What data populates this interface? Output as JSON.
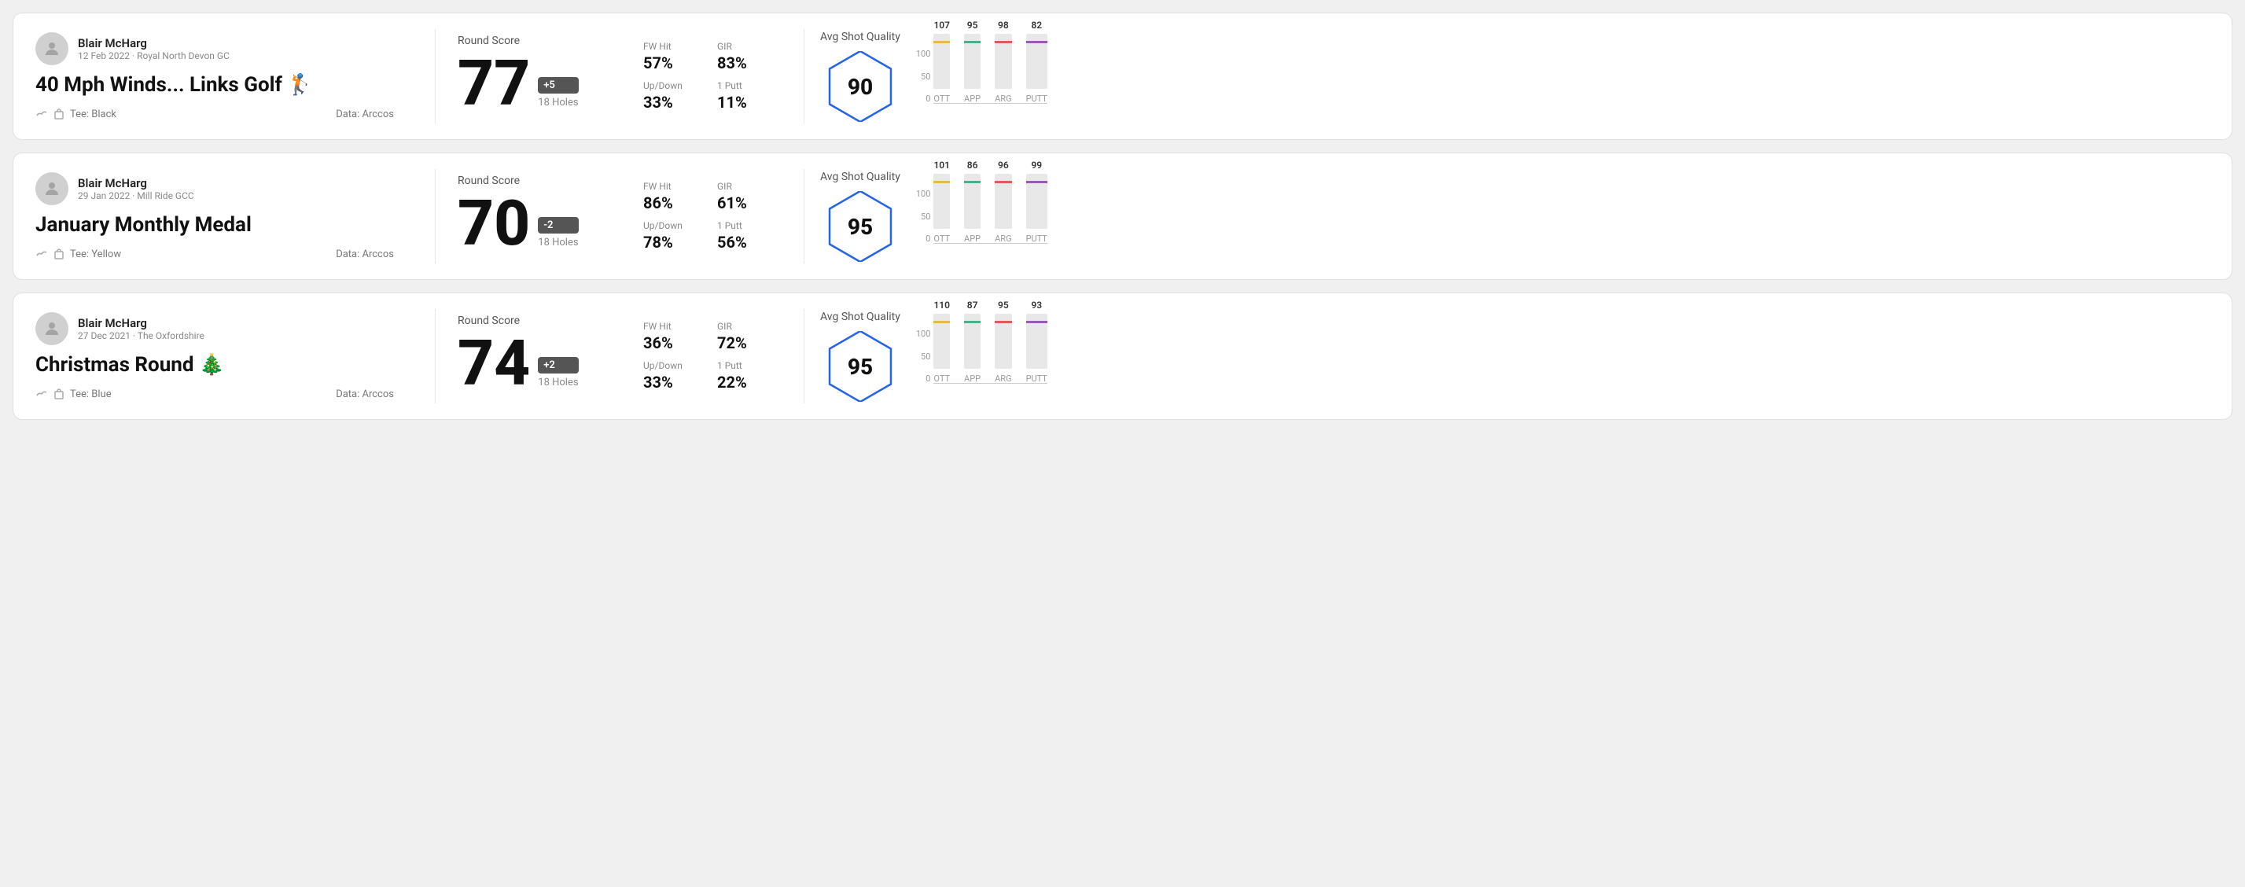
{
  "cards": [
    {
      "id": "card1",
      "user": {
        "name": "Blair McHarg",
        "meta": "12 Feb 2022 · Royal North Devon GC"
      },
      "title": "40 Mph Winds... Links Golf 🏌️",
      "tee": "Tee: Black",
      "data_source": "Data: Arccos",
      "score": {
        "label": "Round Score",
        "number": "77",
        "badge": "+5",
        "holes": "18 Holes"
      },
      "stats": {
        "fw_hit_label": "FW Hit",
        "fw_hit_value": "57%",
        "gir_label": "GIR",
        "gir_value": "83%",
        "updown_label": "Up/Down",
        "updown_value": "33%",
        "oneputt_label": "1 Putt",
        "oneputt_value": "11%"
      },
      "quality": {
        "label": "Avg Shot Quality",
        "score": "90"
      },
      "chart": {
        "y_labels": [
          "100",
          "50",
          "0"
        ],
        "bars": [
          {
            "label": "OTT",
            "value": 107,
            "color": "#e8b84b",
            "max": 120
          },
          {
            "label": "APP",
            "value": 95,
            "color": "#4caf8a",
            "max": 120
          },
          {
            "label": "ARG",
            "value": 98,
            "color": "#e05a5a",
            "max": 120
          },
          {
            "label": "PUTT",
            "value": 82,
            "color": "#9b59b6",
            "max": 120
          }
        ]
      }
    },
    {
      "id": "card2",
      "user": {
        "name": "Blair McHarg",
        "meta": "29 Jan 2022 · Mill Ride GCC"
      },
      "title": "January Monthly Medal",
      "tee": "Tee: Yellow",
      "data_source": "Data: Arccos",
      "score": {
        "label": "Round Score",
        "number": "70",
        "badge": "-2",
        "holes": "18 Holes"
      },
      "stats": {
        "fw_hit_label": "FW Hit",
        "fw_hit_value": "86%",
        "gir_label": "GIR",
        "gir_value": "61%",
        "updown_label": "Up/Down",
        "updown_value": "78%",
        "oneputt_label": "1 Putt",
        "oneputt_value": "56%"
      },
      "quality": {
        "label": "Avg Shot Quality",
        "score": "95"
      },
      "chart": {
        "y_labels": [
          "100",
          "50",
          "0"
        ],
        "bars": [
          {
            "label": "OTT",
            "value": 101,
            "color": "#e8b84b",
            "max": 120
          },
          {
            "label": "APP",
            "value": 86,
            "color": "#4caf8a",
            "max": 120
          },
          {
            "label": "ARG",
            "value": 96,
            "color": "#e05a5a",
            "max": 120
          },
          {
            "label": "PUTT",
            "value": 99,
            "color": "#9b59b6",
            "max": 120
          }
        ]
      }
    },
    {
      "id": "card3",
      "user": {
        "name": "Blair McHarg",
        "meta": "27 Dec 2021 · The Oxfordshire"
      },
      "title": "Christmas Round 🎄",
      "tee": "Tee: Blue",
      "data_source": "Data: Arccos",
      "score": {
        "label": "Round Score",
        "number": "74",
        "badge": "+2",
        "holes": "18 Holes"
      },
      "stats": {
        "fw_hit_label": "FW Hit",
        "fw_hit_value": "36%",
        "gir_label": "GIR",
        "gir_value": "72%",
        "updown_label": "Up/Down",
        "updown_value": "33%",
        "oneputt_label": "1 Putt",
        "oneputt_value": "22%"
      },
      "quality": {
        "label": "Avg Shot Quality",
        "score": "95"
      },
      "chart": {
        "y_labels": [
          "100",
          "50",
          "0"
        ],
        "bars": [
          {
            "label": "OTT",
            "value": 110,
            "color": "#e8b84b",
            "max": 120
          },
          {
            "label": "APP",
            "value": 87,
            "color": "#4caf8a",
            "max": 120
          },
          {
            "label": "ARG",
            "value": 95,
            "color": "#e05a5a",
            "max": 120
          },
          {
            "label": "PUTT",
            "value": 93,
            "color": "#9b59b6",
            "max": 120
          }
        ]
      }
    }
  ]
}
